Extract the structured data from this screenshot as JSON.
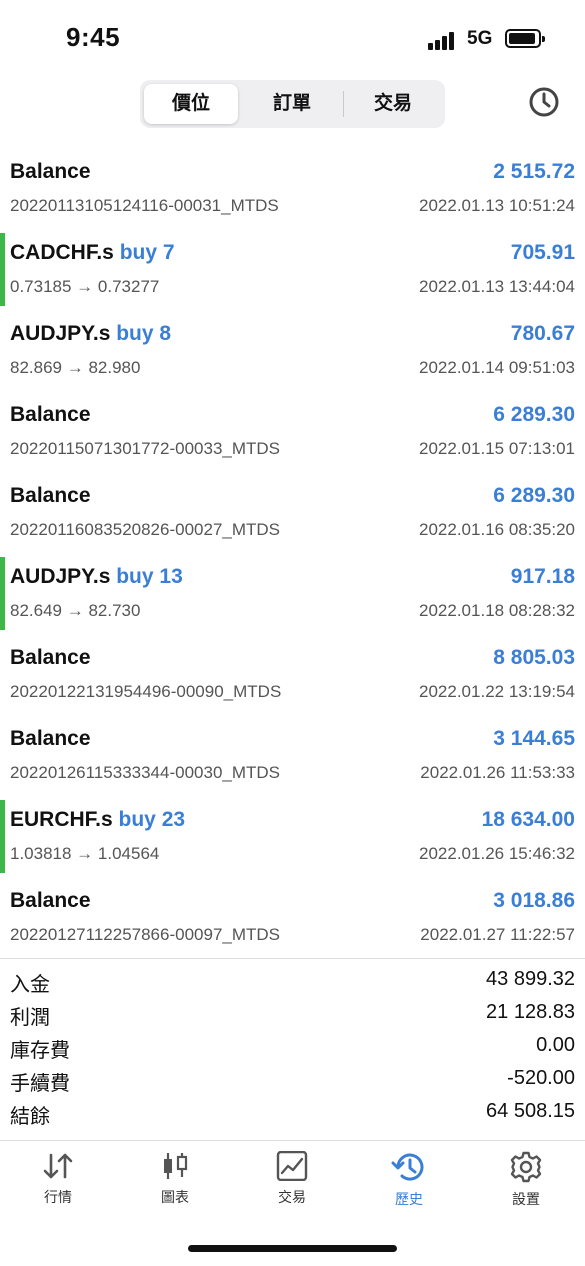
{
  "status_bar": {
    "time": "9:45",
    "network": "5G"
  },
  "segmented": {
    "tabs": [
      "價位",
      "訂單",
      "交易"
    ],
    "active": 0
  },
  "history": [
    {
      "type": "balance",
      "title": "Balance",
      "amount": "2 515.72",
      "sub": "20220113105124116-00031_MTDS",
      "date": "2022.01.13 10:51:24"
    },
    {
      "type": "trade",
      "symbol": "CADCHF.s",
      "op": "buy 7",
      "amount": "705.91",
      "sub": "0.73185 → 0.73277",
      "date": "2022.01.13 13:44:04"
    },
    {
      "type": "trade",
      "symbol": "AUDJPY.s",
      "op": "buy 8",
      "amount": "780.67",
      "sub": "82.869 → 82.980",
      "date": "2022.01.14 09:51:03"
    },
    {
      "type": "balance",
      "title": "Balance",
      "amount": "6 289.30",
      "sub": "20220115071301772-00033_MTDS",
      "date": "2022.01.15 07:13:01"
    },
    {
      "type": "balance",
      "title": "Balance",
      "amount": "6 289.30",
      "sub": "20220116083520826-00027_MTDS",
      "date": "2022.01.16 08:35:20"
    },
    {
      "type": "trade",
      "symbol": "AUDJPY.s",
      "op": "buy 13",
      "amount": "917.18",
      "sub": "82.649 → 82.730",
      "date": "2022.01.18 08:28:32"
    },
    {
      "type": "balance",
      "title": "Balance",
      "amount": "8 805.03",
      "sub": "20220122131954496-00090_MTDS",
      "date": "2022.01.22 13:19:54"
    },
    {
      "type": "balance",
      "title": "Balance",
      "amount": "3 144.65",
      "sub": "20220126115333344-00030_MTDS",
      "date": "2022.01.26 11:53:33"
    },
    {
      "type": "trade",
      "symbol": "EURCHF.s",
      "op": "buy 23",
      "amount": "18 634.00",
      "sub": "1.03818 → 1.04564",
      "date": "2022.01.26 15:46:32"
    },
    {
      "type": "balance",
      "title": "Balance",
      "amount": "3 018.86",
      "sub": "20220127112257866-00097_MTDS",
      "date": "2022.01.27 11:22:57"
    }
  ],
  "summary": [
    {
      "label": "入金",
      "value": "43 899.32"
    },
    {
      "label": "利潤",
      "value": "21 128.83"
    },
    {
      "label": "庫存費",
      "value": "0.00"
    },
    {
      "label": "手續費",
      "value": "-520.00"
    },
    {
      "label": "結餘",
      "value": "64 508.15"
    }
  ],
  "tabbar": [
    {
      "label": "行情",
      "icon": "arrows-updown-icon"
    },
    {
      "label": "圖表",
      "icon": "candlestick-icon"
    },
    {
      "label": "交易",
      "icon": "trade-chart-icon"
    },
    {
      "label": "歷史",
      "icon": "history-clock-icon"
    },
    {
      "label": "設置",
      "icon": "gear-icon"
    }
  ],
  "colors": {
    "accent": "#3a7fd5",
    "trade_marker": "#3db74a",
    "text": "#111111",
    "secondary": "#555555"
  }
}
